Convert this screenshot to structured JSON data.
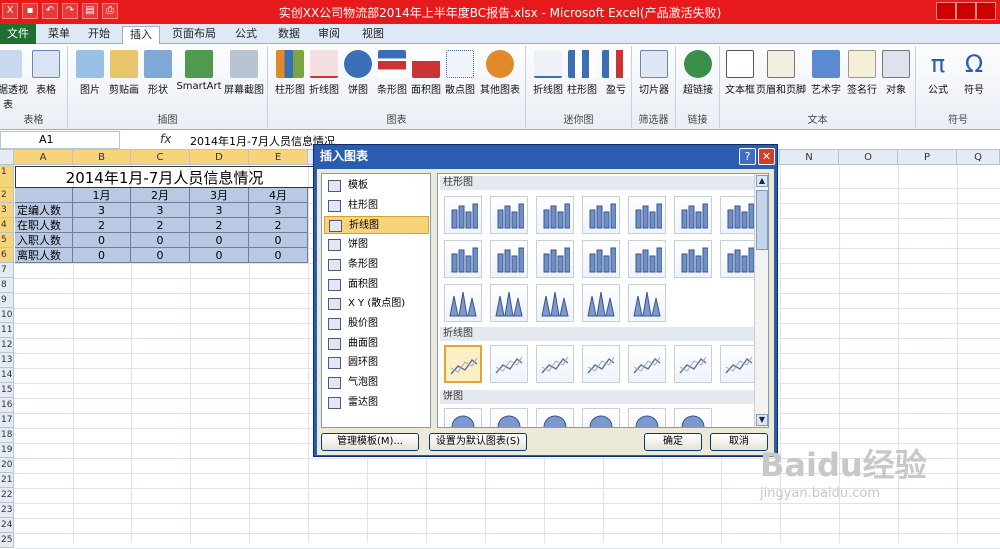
{
  "window": {
    "title": "实创XX公司物流部2014年上半年度BC报告.xlsx  -  Microsoft Excel(产品激活失败)"
  },
  "ribbon_tabs": [
    "文件",
    "菜单",
    "开始",
    "插入",
    "页面布局",
    "公式",
    "数据",
    "审阅",
    "视图"
  ],
  "active_tab": "插入",
  "ribbon": {
    "groups": [
      "表格",
      "插图",
      "图表",
      "迷你图",
      "筛选器",
      "链接",
      "文本",
      "符号"
    ],
    "buttons": [
      "数据透视表",
      "表格",
      "图片",
      "剪贴画",
      "形状",
      "SmartArt",
      "屏幕截图",
      "柱形图",
      "折线图",
      "饼图",
      "条形图",
      "面积图",
      "散点图",
      "其他图表",
      "折线图",
      "柱形图",
      "盈亏",
      "切片器",
      "超链接",
      "文本框",
      "页眉和页脚",
      "艺术字",
      "签名行",
      "对象",
      "公式",
      "符号"
    ]
  },
  "namebox": "A1",
  "fx": "fx",
  "formula": "2014年1月-7月人员信息情况",
  "columns": [
    "A",
    "B",
    "C",
    "D",
    "E",
    "F",
    "G",
    "H",
    "I",
    "J",
    "K",
    "L",
    "M",
    "N",
    "O",
    "P",
    "Q"
  ],
  "rows": [
    "1",
    "2",
    "3",
    "4",
    "5",
    "6",
    "7",
    "8",
    "9",
    "10",
    "11",
    "12",
    "13",
    "14",
    "15",
    "16",
    "17",
    "18",
    "19",
    "20",
    "21",
    "22",
    "23",
    "24",
    "25"
  ],
  "sheet": {
    "title": "2014年1月-7月人员信息情况",
    "header": [
      "",
      "1月",
      "2月",
      "3月",
      "4月"
    ],
    "data": [
      [
        "定编人数",
        "3",
        "3",
        "3",
        "3"
      ],
      [
        "在职人数",
        "2",
        "2",
        "2",
        "2"
      ],
      [
        "入职人数",
        "0",
        "0",
        "0",
        "0"
      ],
      [
        "离职人数",
        "0",
        "0",
        "0",
        "0"
      ]
    ]
  },
  "dialog": {
    "title": "插入图表",
    "help": "?",
    "close": "✕",
    "categories": [
      "模板",
      "柱形图",
      "折线图",
      "饼图",
      "条形图",
      "面积图",
      "X Y (散点图)",
      "股价图",
      "曲面图",
      "圆环图",
      "气泡图",
      "雷达图"
    ],
    "selected_category": "折线图",
    "sections": [
      "柱形图",
      "折线图",
      "饼图"
    ],
    "buttons": {
      "manage": "管理模板(M)...",
      "set_default": "设置为默认图表(S)",
      "ok": "确定",
      "cancel": "取消"
    }
  },
  "watermark": {
    "text": "Baidu经验",
    "sub": "jingyan.baidu.com"
  }
}
